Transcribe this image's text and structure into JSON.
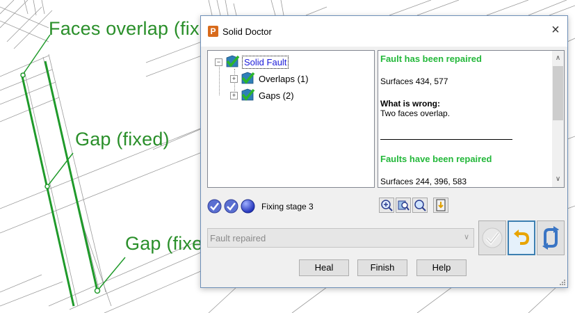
{
  "scene": {
    "labels": [
      "Faces overlap (fix",
      "Gap (fixed)",
      "Gap (fixe"
    ]
  },
  "dialog": {
    "title": "Solid Doctor",
    "close_label": "×",
    "tree": {
      "root": "Solid Fault",
      "children": [
        "Overlaps (1)",
        "Gaps (2)"
      ]
    },
    "info": {
      "heading1": "Fault has been repaired",
      "surfaces1": "Surfaces 434, 577",
      "what_wrong": "What is wrong:",
      "description": "Two faces overlap.",
      "heading2": "Faults have been repaired",
      "surfaces2": "Surfaces 244, 396, 583"
    },
    "stage_label": "Fixing stage 3",
    "combo_value": "Fault repaired",
    "buttons": {
      "heal": "Heal",
      "finish": "Finish",
      "help": "Help"
    },
    "colors": {
      "fault_green": "#23b83a",
      "cad_label_green": "#2a8f2a",
      "accent_blue": "#3c7fb1"
    },
    "icons": [
      "check-icon",
      "stage-sphere-icon",
      "zoom-in-icon",
      "find-icon",
      "magnifier-icon",
      "export-icon",
      "accept-icon",
      "undo-icon",
      "refresh-icon"
    ]
  }
}
